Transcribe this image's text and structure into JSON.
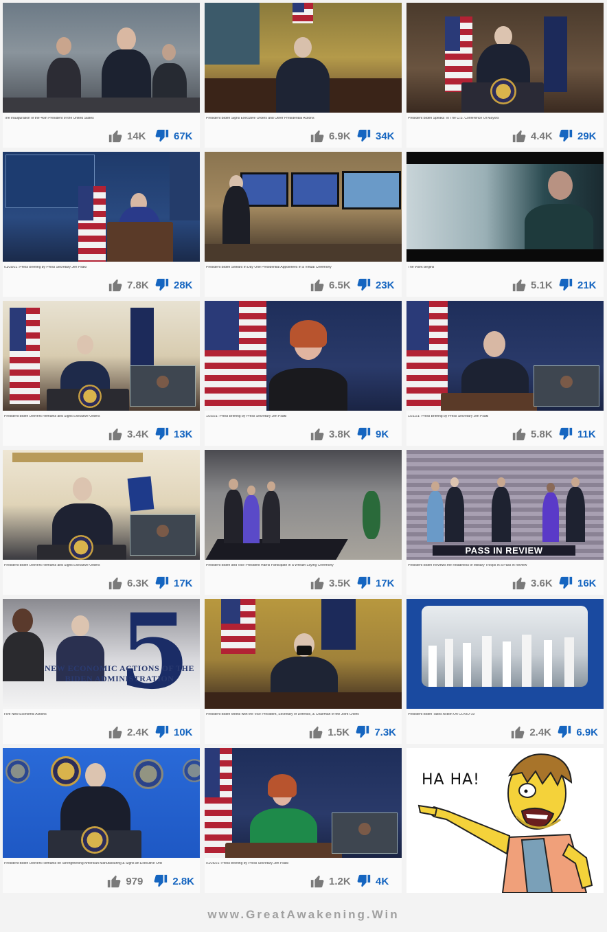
{
  "colors": {
    "like_gray": "#7a7a7a",
    "dislike_blue": "#1565c0",
    "footer_gray": "#a0a0a0"
  },
  "icons": {
    "like": "thumbs-up-icon",
    "dislike": "thumbs-down-icon"
  },
  "videos": [
    {
      "title": "The Inauguration of the 46th President of the United States",
      "like_count": "14K",
      "dislike_count": "67K"
    },
    {
      "title": "President Biden Signs Executive Orders and Other Presidential Actions",
      "like_count": "6.9K",
      "dislike_count": "34K"
    },
    {
      "title": "President Biden Speaks To The U.S. Conference Of Mayors",
      "like_count": "4.4K",
      "dislike_count": "29K"
    },
    {
      "title": "01/20/21: Press Briefing by Press Secretary Jen Psaki",
      "like_count": "7.8K",
      "dislike_count": "28K"
    },
    {
      "title": "President Biden Swears in Day One Presidential Appointees in a Virtual Ceremony",
      "like_count": "6.5K",
      "dislike_count": "23K"
    },
    {
      "title": "The Work Begins",
      "like_count": "5.1K",
      "dislike_count": "21K"
    },
    {
      "title": "President Biden Delivers Remarks and Signs Executive Orders",
      "like_count": "3.4K",
      "dislike_count": "13K"
    },
    {
      "title": "1/25/21: Press Briefing by Press Secretary Jen Psaki",
      "like_count": "3.8K",
      "dislike_count": "9K"
    },
    {
      "title": "1/21/21: Press Briefing by Press Secretary Jen Psaki",
      "like_count": "5.8K",
      "dislike_count": "11K"
    },
    {
      "title": "President Biden Delivers Remarks and Signs Executive Orders",
      "like_count": "6.3K",
      "dislike_count": "17K"
    },
    {
      "title": "President Biden and Vice President Harris Participate in a Wreath Laying Ceremony",
      "like_count": "3.5K",
      "dislike_count": "17K"
    },
    {
      "title": "President Biden Reviews the Readiness of Military Troops in a Pass in Review",
      "like_count": "3.6K",
      "dislike_count": "16K",
      "banner": "PASS IN REVIEW"
    },
    {
      "title": "Five New Economic Actions",
      "like_count": "2.4K",
      "dislike_count": "10K",
      "big_number": "5",
      "overlay_text": "NEW ECONOMIC ACTIONS OF THE BIDEN ADMINISTRATION"
    },
    {
      "title": "President Biden Meets with the Vice President, Secretary of Defense, & Chairman of the Joint Chiefs",
      "like_count": "1.5K",
      "dislike_count": "7.3K"
    },
    {
      "title": "President Biden Takes Action On COVID-19",
      "like_count": "2.4K",
      "dislike_count": "6.9K"
    },
    {
      "title": "President Biden Delivers Remarks on Strengthening American Manufacturing & Signs an Executive Order",
      "like_count": "979",
      "dislike_count": "2.8K"
    },
    {
      "title": "01/26/21: Press Briefing by Press Secretary Jen Psaki",
      "like_count": "1.2K",
      "dislike_count": "4K"
    }
  ],
  "meme": {
    "text": "HA HA!"
  },
  "footer": {
    "text": "www.GreatAwakening.Win"
  }
}
